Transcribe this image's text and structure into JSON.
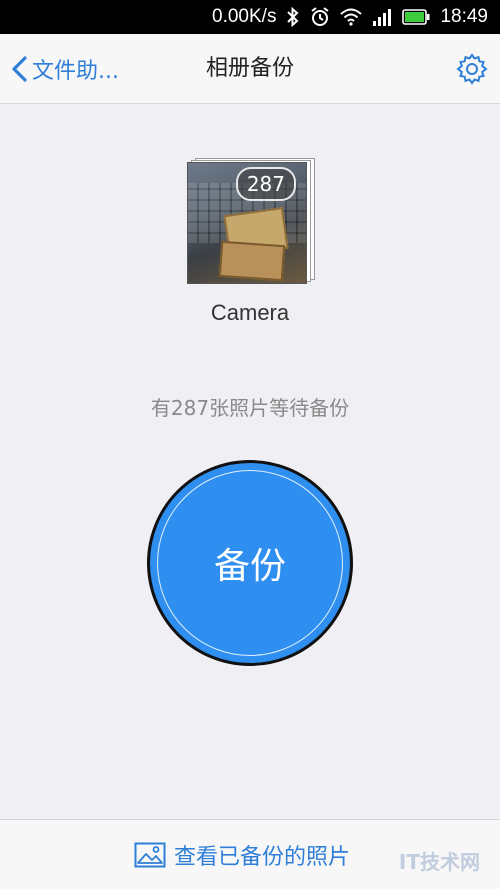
{
  "status_bar": {
    "network_speed": "0.00K/s",
    "time": "18:49",
    "icons": [
      "bluetooth-icon",
      "alarm-icon",
      "wifi-icon",
      "signal-icon",
      "battery-icon"
    ]
  },
  "nav": {
    "back_label": "文件助...",
    "title": "相册备份",
    "settings_icon": "gear-icon"
  },
  "album": {
    "name": "Camera",
    "photo_count": "287"
  },
  "pending_text": "有287张照片等待备份",
  "backup_button_label": "备份",
  "bottom": {
    "view_backed_up_label": "查看已备份的照片",
    "watermark_text": "IT技术网"
  },
  "colors": {
    "accent": "#2f7fd8",
    "button_blue": "#2e8ff0",
    "background": "#efeff4"
  }
}
